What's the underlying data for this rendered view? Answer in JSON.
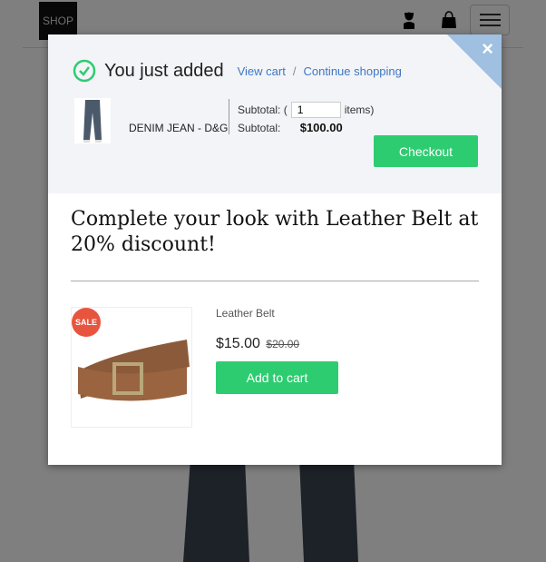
{
  "header": {
    "logo": "SHOP",
    "icons": [
      "user-icon",
      "shopping-bag-icon",
      "hamburger-menu-icon"
    ]
  },
  "modal": {
    "close_label": "×",
    "title": "You just added",
    "view_cart": "View cart",
    "separator": "/",
    "continue_shopping": "Continue shopping",
    "product_name": "DENIM JEAN - D&G",
    "subtotal_label": "Subtotal: (",
    "quantity": "1",
    "items_label": "items)",
    "subtotal_label2": "Subtotal:",
    "subtotal_value": "$100.00",
    "checkout_label": "Checkout"
  },
  "upsell": {
    "title": "Complete your look with Leather Belt at 20% discount!",
    "badge": "SALE",
    "product_name": "Leather Belt",
    "price": "$15.00",
    "old_price": "$20.00",
    "add_to_cart": "Add to cart"
  },
  "colors": {
    "accent_green": "#2ecc71",
    "link_blue": "#3d77c4",
    "sale_red": "#e8553e",
    "corner_blue": "#9fc0e0"
  }
}
